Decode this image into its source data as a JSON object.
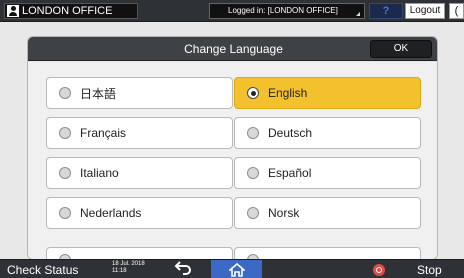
{
  "header": {
    "office_name": "LONDON OFFICE",
    "logged_in": "Logged in: [LONDON OFFICE]",
    "help_label": "?",
    "logout_label": "Logout",
    "side_label": "(",
    "office_icon": "user-icon"
  },
  "dialog": {
    "title": "Change Language",
    "ok_label": "OK",
    "languages": [
      {
        "label": "日本語",
        "selected": false
      },
      {
        "label": "English",
        "selected": true
      },
      {
        "label": "Français",
        "selected": false
      },
      {
        "label": "Deutsch",
        "selected": false
      },
      {
        "label": "Italiano",
        "selected": false
      },
      {
        "label": "Español",
        "selected": false
      },
      {
        "label": "Nederlands",
        "selected": false
      },
      {
        "label": "Norsk",
        "selected": false
      }
    ],
    "selected_color": "#f3c12e"
  },
  "footer": {
    "check_status": "Check Status",
    "date": "18 Jul. 2018",
    "time": "11:18",
    "back_icon": "back-arrow-icon",
    "home_icon": "home-icon",
    "stop_label": "Stop",
    "stop_icon": "stop-icon",
    "home_color": "#3d69c6",
    "stop_color": "#e24a48"
  }
}
